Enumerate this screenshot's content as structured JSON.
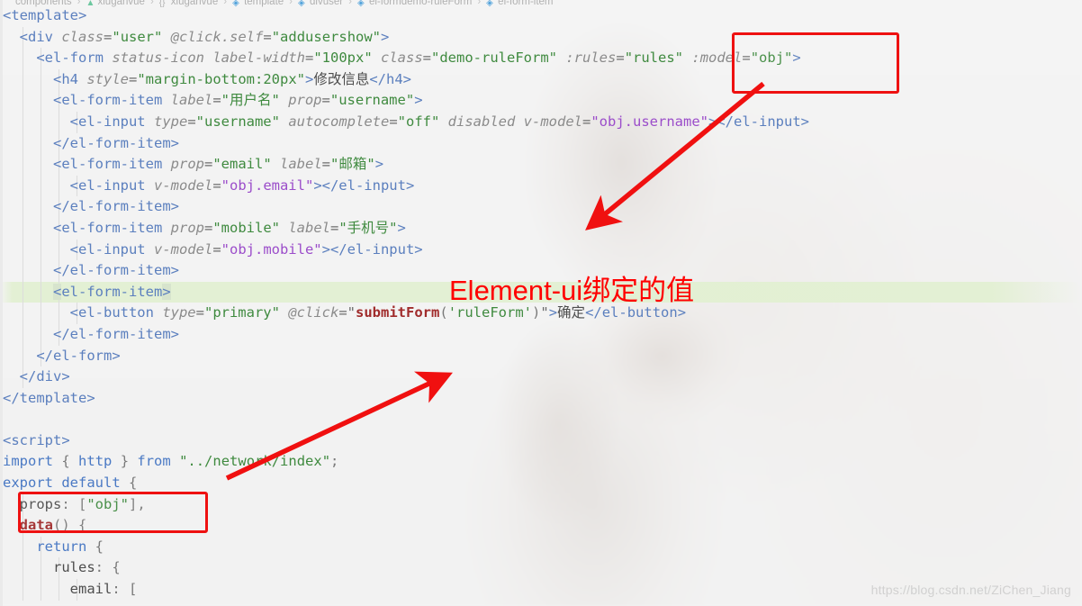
{
  "editor": {
    "breadcrumb": [
      {
        "icon": "folder-icon",
        "label": "components"
      },
      {
        "icon": "vue-icon",
        "label": "xiuganvue"
      },
      {
        "icon": "brace-icon",
        "label": "xiuganvue"
      },
      {
        "icon": "tag-icon",
        "label": "template"
      },
      {
        "icon": "tag-icon",
        "label": "divuser"
      },
      {
        "icon": "tag-icon",
        "label": "el-formdemo-ruleForm"
      },
      {
        "icon": "tag-icon",
        "label": "el-form-item"
      }
    ],
    "separator": "›",
    "highlighted_line_index": 13,
    "lines": [
      {
        "indent": 0,
        "guides": [],
        "tokens": [
          {
            "t": "tag",
            "v": "<template>"
          }
        ]
      },
      {
        "indent": 0,
        "guides": [
          25
        ],
        "tokens": [
          {
            "t": "plainpad",
            "v": "  "
          },
          {
            "t": "tag",
            "v": "<div "
          },
          {
            "t": "attr",
            "v": "class"
          },
          {
            "t": "eq",
            "v": "="
          },
          {
            "t": "str",
            "v": "\"user\""
          },
          {
            "t": "plain",
            "v": " "
          },
          {
            "t": "attr",
            "v": "@click.self"
          },
          {
            "t": "eq",
            "v": "="
          },
          {
            "t": "str",
            "v": "\"addusershow\""
          },
          {
            "t": "tag",
            "v": ">"
          }
        ]
      },
      {
        "indent": 0,
        "guides": [
          25,
          45
        ],
        "tokens": [
          {
            "t": "plainpad",
            "v": "    "
          },
          {
            "t": "tag",
            "v": "<el-form "
          },
          {
            "t": "attr",
            "v": "status-icon"
          },
          {
            "t": "plain",
            "v": " "
          },
          {
            "t": "attr",
            "v": "label-width"
          },
          {
            "t": "eq",
            "v": "="
          },
          {
            "t": "str",
            "v": "\"100px\""
          },
          {
            "t": "plain",
            "v": " "
          },
          {
            "t": "attr",
            "v": "class"
          },
          {
            "t": "eq",
            "v": "="
          },
          {
            "t": "str",
            "v": "\"demo-ruleForm\""
          },
          {
            "t": "plain",
            "v": " "
          },
          {
            "t": "attr",
            "v": ":rules"
          },
          {
            "t": "eq",
            "v": "="
          },
          {
            "t": "str",
            "v": "\"rules\""
          },
          {
            "t": "plain",
            "v": " "
          },
          {
            "t": "attr",
            "v": ":model"
          },
          {
            "t": "eq",
            "v": "="
          },
          {
            "t": "str",
            "v": "\"obj\""
          },
          {
            "t": "tag",
            "v": ">"
          }
        ]
      },
      {
        "indent": 0,
        "guides": [
          25,
          45,
          65
        ],
        "tokens": [
          {
            "t": "plainpad",
            "v": "      "
          },
          {
            "t": "tag",
            "v": "<h4 "
          },
          {
            "t": "attr",
            "v": "style"
          },
          {
            "t": "eq",
            "v": "="
          },
          {
            "t": "str",
            "v": "\"margin-bottom:20px\""
          },
          {
            "t": "tag",
            "v": ">"
          },
          {
            "t": "cn",
            "v": "修改信息"
          },
          {
            "t": "tag",
            "v": "</h4>"
          }
        ]
      },
      {
        "indent": 0,
        "guides": [
          25,
          45,
          65
        ],
        "tokens": [
          {
            "t": "plainpad",
            "v": "      "
          },
          {
            "t": "tag",
            "v": "<el-form-item "
          },
          {
            "t": "attr",
            "v": "label"
          },
          {
            "t": "eq",
            "v": "="
          },
          {
            "t": "str",
            "v": "\"用户名\""
          },
          {
            "t": "plain",
            "v": " "
          },
          {
            "t": "attr",
            "v": "prop"
          },
          {
            "t": "eq",
            "v": "="
          },
          {
            "t": "str",
            "v": "\"username\""
          },
          {
            "t": "tag",
            "v": ">"
          }
        ]
      },
      {
        "indent": 0,
        "guides": [
          25,
          45,
          65,
          85
        ],
        "tokens": [
          {
            "t": "plainpad",
            "v": "        "
          },
          {
            "t": "tag",
            "v": "<el-input "
          },
          {
            "t": "attr",
            "v": "type"
          },
          {
            "t": "eq",
            "v": "="
          },
          {
            "t": "str",
            "v": "\"username\""
          },
          {
            "t": "plain",
            "v": " "
          },
          {
            "t": "attr",
            "v": "autocomplete"
          },
          {
            "t": "eq",
            "v": "="
          },
          {
            "t": "str",
            "v": "\"off\""
          },
          {
            "t": "plain",
            "v": " "
          },
          {
            "t": "attr",
            "v": "disabled"
          },
          {
            "t": "plain",
            "v": " "
          },
          {
            "t": "attr",
            "v": "v-model"
          },
          {
            "t": "eq",
            "v": "="
          },
          {
            "t": "purple",
            "v": "\"obj.username\""
          },
          {
            "t": "tag",
            "v": "></el-input>"
          }
        ]
      },
      {
        "indent": 0,
        "guides": [
          25,
          45,
          65
        ],
        "tokens": [
          {
            "t": "plainpad",
            "v": "      "
          },
          {
            "t": "tag",
            "v": "</el-form-item>"
          }
        ]
      },
      {
        "indent": 0,
        "guides": [
          25,
          45,
          65
        ],
        "tokens": [
          {
            "t": "plainpad",
            "v": "      "
          },
          {
            "t": "tag",
            "v": "<el-form-item "
          },
          {
            "t": "attr",
            "v": "prop"
          },
          {
            "t": "eq",
            "v": "="
          },
          {
            "t": "str",
            "v": "\"email\""
          },
          {
            "t": "plain",
            "v": " "
          },
          {
            "t": "attr",
            "v": "label"
          },
          {
            "t": "eq",
            "v": "="
          },
          {
            "t": "str",
            "v": "\"邮箱\""
          },
          {
            "t": "tag",
            "v": ">"
          }
        ]
      },
      {
        "indent": 0,
        "guides": [
          25,
          45,
          65,
          85
        ],
        "tokens": [
          {
            "t": "plainpad",
            "v": "        "
          },
          {
            "t": "tag",
            "v": "<el-input "
          },
          {
            "t": "attr",
            "v": "v-model"
          },
          {
            "t": "eq",
            "v": "="
          },
          {
            "t": "purple",
            "v": "\"obj.email\""
          },
          {
            "t": "tag",
            "v": "></el-input>"
          }
        ]
      },
      {
        "indent": 0,
        "guides": [
          25,
          45,
          65
        ],
        "tokens": [
          {
            "t": "plainpad",
            "v": "      "
          },
          {
            "t": "tag",
            "v": "</el-form-item>"
          }
        ]
      },
      {
        "indent": 0,
        "guides": [
          25,
          45,
          65
        ],
        "tokens": [
          {
            "t": "plainpad",
            "v": "      "
          },
          {
            "t": "tag",
            "v": "<el-form-item "
          },
          {
            "t": "attr",
            "v": "prop"
          },
          {
            "t": "eq",
            "v": "="
          },
          {
            "t": "str",
            "v": "\"mobile\""
          },
          {
            "t": "plain",
            "v": " "
          },
          {
            "t": "attr",
            "v": "label"
          },
          {
            "t": "eq",
            "v": "="
          },
          {
            "t": "str",
            "v": "\"手机号\""
          },
          {
            "t": "tag",
            "v": ">"
          }
        ]
      },
      {
        "indent": 0,
        "guides": [
          25,
          45,
          65,
          85
        ],
        "tokens": [
          {
            "t": "plainpad",
            "v": "        "
          },
          {
            "t": "tag",
            "v": "<el-input "
          },
          {
            "t": "attr",
            "v": "v-model"
          },
          {
            "t": "eq",
            "v": "="
          },
          {
            "t": "purple",
            "v": "\"obj.mobile\""
          },
          {
            "t": "tag",
            "v": "></el-input>"
          }
        ]
      },
      {
        "indent": 0,
        "guides": [
          25,
          45,
          65
        ],
        "tokens": [
          {
            "t": "plainpad",
            "v": "      "
          },
          {
            "t": "tag",
            "v": "</el-form-item>"
          }
        ]
      },
      {
        "indent": 0,
        "guides": [
          25,
          45,
          65
        ],
        "tokens": [
          {
            "t": "plainpad",
            "v": "      "
          },
          {
            "t": "selbracket",
            "v": "<"
          },
          {
            "t": "tag",
            "v": "el-form-item"
          },
          {
            "t": "selbracket",
            "v": ">"
          }
        ]
      },
      {
        "indent": 0,
        "guides": [
          25,
          45,
          65,
          85
        ],
        "tokens": [
          {
            "t": "plainpad",
            "v": "        "
          },
          {
            "t": "tag",
            "v": "<el-button "
          },
          {
            "t": "attr",
            "v": "type"
          },
          {
            "t": "eq",
            "v": "="
          },
          {
            "t": "str",
            "v": "\"primary\""
          },
          {
            "t": "plain",
            "v": " "
          },
          {
            "t": "attr",
            "v": "@click"
          },
          {
            "t": "eq",
            "v": "="
          },
          {
            "t": "eq",
            "v": "\""
          },
          {
            "t": "fnred",
            "v": "submitForm"
          },
          {
            "t": "punct",
            "v": "("
          },
          {
            "t": "str",
            "v": "'ruleForm'"
          },
          {
            "t": "punct",
            "v": ")"
          },
          {
            "t": "eq",
            "v": "\""
          },
          {
            "t": "tag",
            "v": ">"
          },
          {
            "t": "cn",
            "v": "确定"
          },
          {
            "t": "tag",
            "v": "</el-button>"
          }
        ]
      },
      {
        "indent": 0,
        "guides": [
          25,
          45,
          65
        ],
        "tokens": [
          {
            "t": "plainpad",
            "v": "      "
          },
          {
            "t": "tag",
            "v": "</el-form-item>"
          }
        ]
      },
      {
        "indent": 0,
        "guides": [
          25,
          45
        ],
        "tokens": [
          {
            "t": "plainpad",
            "v": "    "
          },
          {
            "t": "tag",
            "v": "</el-form>"
          }
        ]
      },
      {
        "indent": 0,
        "guides": [
          25
        ],
        "tokens": [
          {
            "t": "plainpad",
            "v": "  "
          },
          {
            "t": "tag",
            "v": "</div>"
          }
        ]
      },
      {
        "indent": 0,
        "guides": [],
        "tokens": [
          {
            "t": "tag",
            "v": "</template>"
          }
        ]
      },
      {
        "indent": 0,
        "guides": [],
        "tokens": []
      },
      {
        "indent": 0,
        "guides": [],
        "tokens": [
          {
            "t": "tag",
            "v": "<script>"
          }
        ]
      },
      {
        "indent": 0,
        "guides": [],
        "tokens": [
          {
            "t": "kw",
            "v": "import"
          },
          {
            "t": "plain",
            "v": " "
          },
          {
            "t": "punct",
            "v": "{"
          },
          {
            "t": "plain",
            "v": " "
          },
          {
            "t": "kw",
            "v": "http"
          },
          {
            "t": "plain",
            "v": " "
          },
          {
            "t": "punct",
            "v": "}"
          },
          {
            "t": "plain",
            "v": " "
          },
          {
            "t": "kw",
            "v": "from"
          },
          {
            "t": "plain",
            "v": " "
          },
          {
            "t": "str",
            "v": "\"../network/index\""
          },
          {
            "t": "punct",
            "v": ";"
          }
        ]
      },
      {
        "indent": 0,
        "guides": [],
        "tokens": [
          {
            "t": "kw",
            "v": "export default"
          },
          {
            "t": "plain",
            "v": " "
          },
          {
            "t": "punct",
            "v": "{"
          }
        ]
      },
      {
        "indent": 0,
        "guides": [
          25
        ],
        "tokens": [
          {
            "t": "plainpad",
            "v": "  "
          },
          {
            "t": "plain",
            "v": "props"
          },
          {
            "t": "punct",
            "v": ": ["
          },
          {
            "t": "str",
            "v": "\"obj\""
          },
          {
            "t": "punct",
            "v": "],"
          }
        ]
      },
      {
        "indent": 0,
        "guides": [
          25
        ],
        "tokens": [
          {
            "t": "plainpad",
            "v": "  "
          },
          {
            "t": "fnred",
            "v": "data"
          },
          {
            "t": "punct",
            "v": "() {"
          }
        ]
      },
      {
        "indent": 0,
        "guides": [
          25,
          45
        ],
        "tokens": [
          {
            "t": "plainpad",
            "v": "    "
          },
          {
            "t": "kw",
            "v": "return"
          },
          {
            "t": "plain",
            "v": " "
          },
          {
            "t": "punct",
            "v": "{"
          }
        ]
      },
      {
        "indent": 0,
        "guides": [
          25,
          45,
          65
        ],
        "tokens": [
          {
            "t": "plainpad",
            "v": "      "
          },
          {
            "t": "plain",
            "v": "rules"
          },
          {
            "t": "punct",
            "v": ": {"
          }
        ]
      },
      {
        "indent": 0,
        "guides": [
          25,
          45,
          65,
          85
        ],
        "tokens": [
          {
            "t": "plainpad",
            "v": "        "
          },
          {
            "t": "plain",
            "v": "email"
          },
          {
            "t": "punct",
            "v": ": ["
          }
        ]
      }
    ]
  },
  "annotations": {
    "label_text": "Element-ui绑定的值",
    "accent_color": "#ff0000",
    "boxes": [
      {
        "name": "model-obj-highlight",
        "target": ":model=\"obj\">"
      },
      {
        "name": "props-obj-highlight",
        "target": "props: [\"obj\"],"
      }
    ],
    "arrows": [
      {
        "name": "arrow-model-to-username",
        "direction": "down-left"
      },
      {
        "name": "arrow-import-to-form",
        "direction": "up-right"
      }
    ]
  },
  "watermark": {
    "text": "https://blog.csdn.net/ZiChen_Jiang"
  }
}
